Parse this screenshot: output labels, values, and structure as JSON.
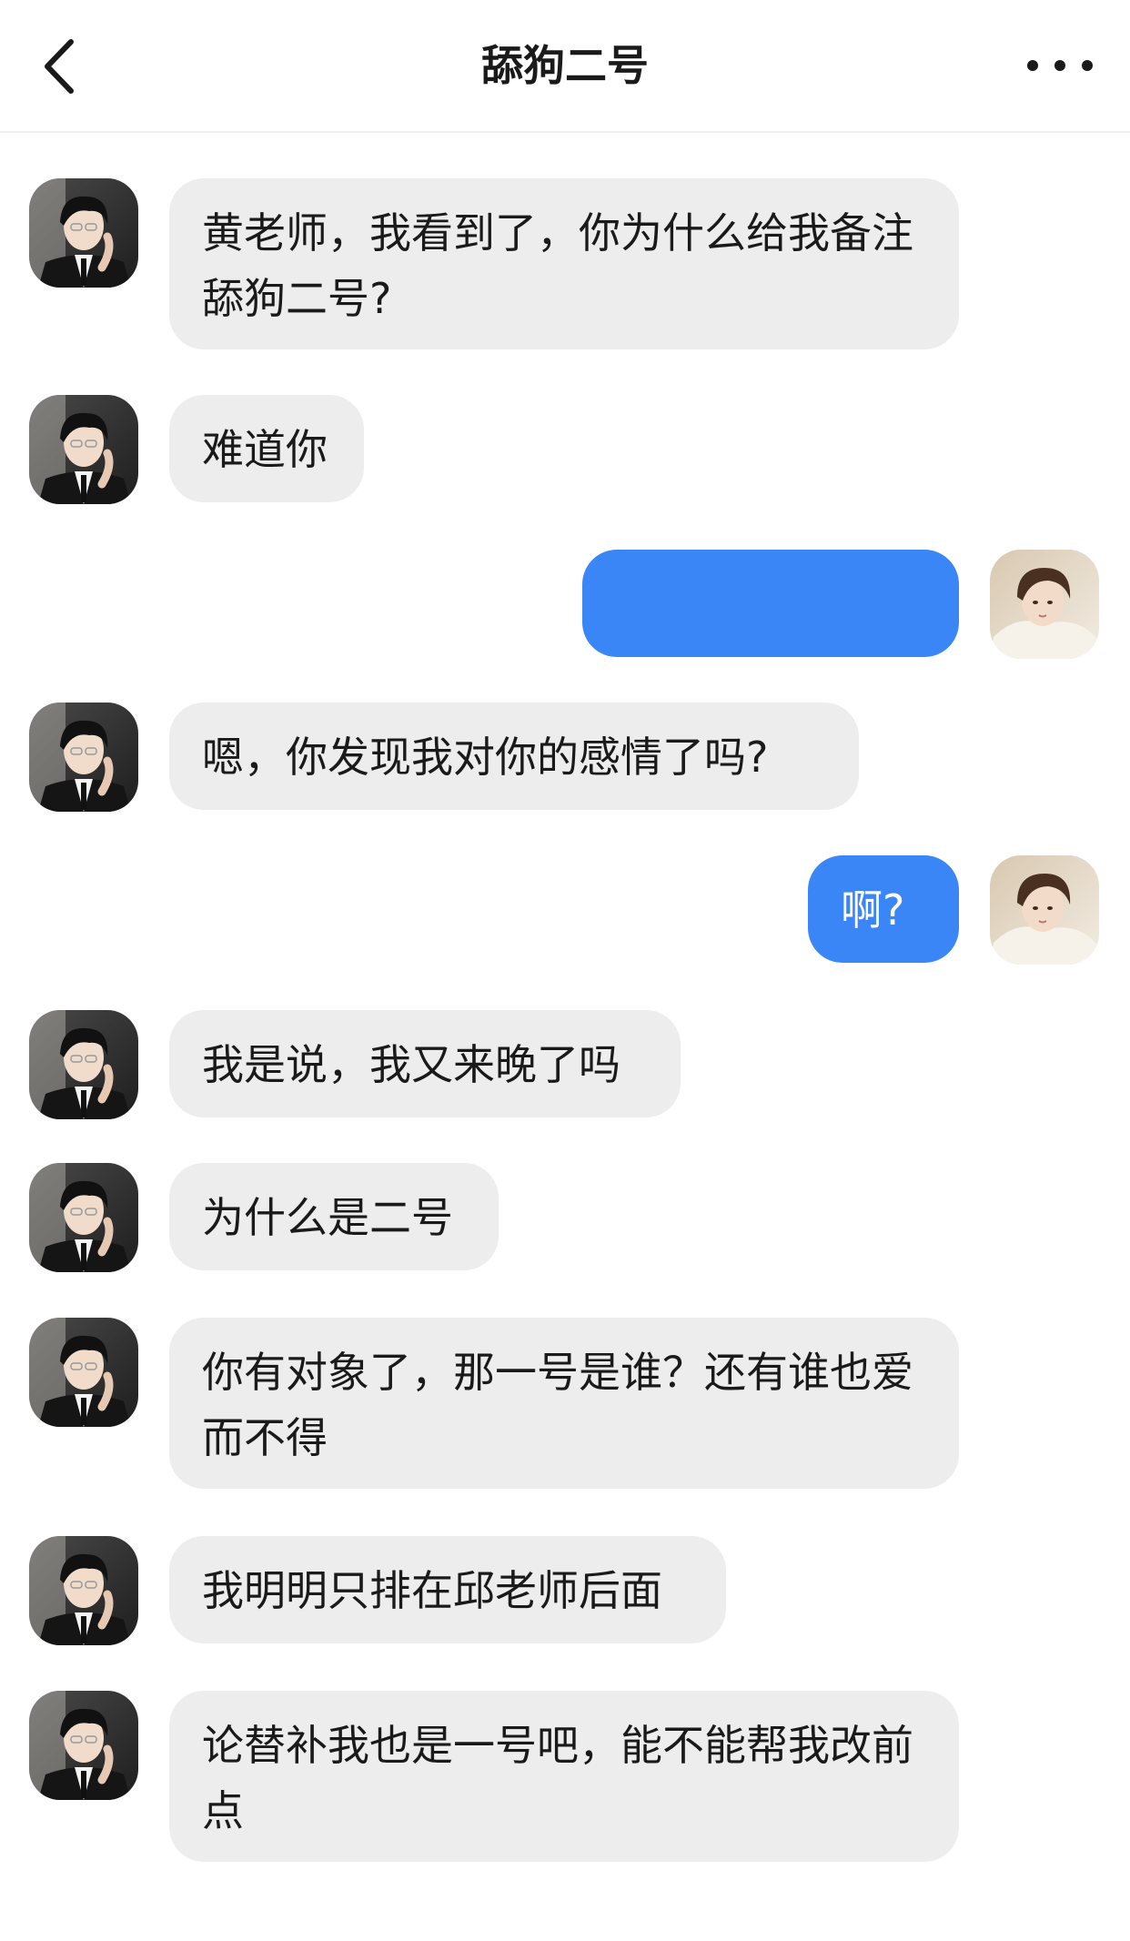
{
  "header": {
    "title": "舔狗二号"
  },
  "messages": [
    {
      "side": "in",
      "text": "黄老师，我看到了，你为什么给我备注舔狗二号?"
    },
    {
      "side": "in",
      "text": "难道你"
    },
    {
      "side": "out",
      "text": ""
    },
    {
      "side": "in",
      "text": "嗯，你发现我对你的感情了吗?"
    },
    {
      "side": "out",
      "text": "啊?"
    },
    {
      "side": "in",
      "text": "我是说，我又来晚了吗"
    },
    {
      "side": "in",
      "text": "为什么是二号"
    },
    {
      "side": "in",
      "text": "你有对象了，那一号是谁？还有谁也爱而不得"
    },
    {
      "side": "in",
      "text": "我明明只排在邱老师后面"
    },
    {
      "side": "in",
      "text": "论替补我也是一号吧，能不能帮我改前点"
    }
  ],
  "colors": {
    "outgoing_bubble": "#3a86f7",
    "incoming_bubble": "#ededed"
  }
}
